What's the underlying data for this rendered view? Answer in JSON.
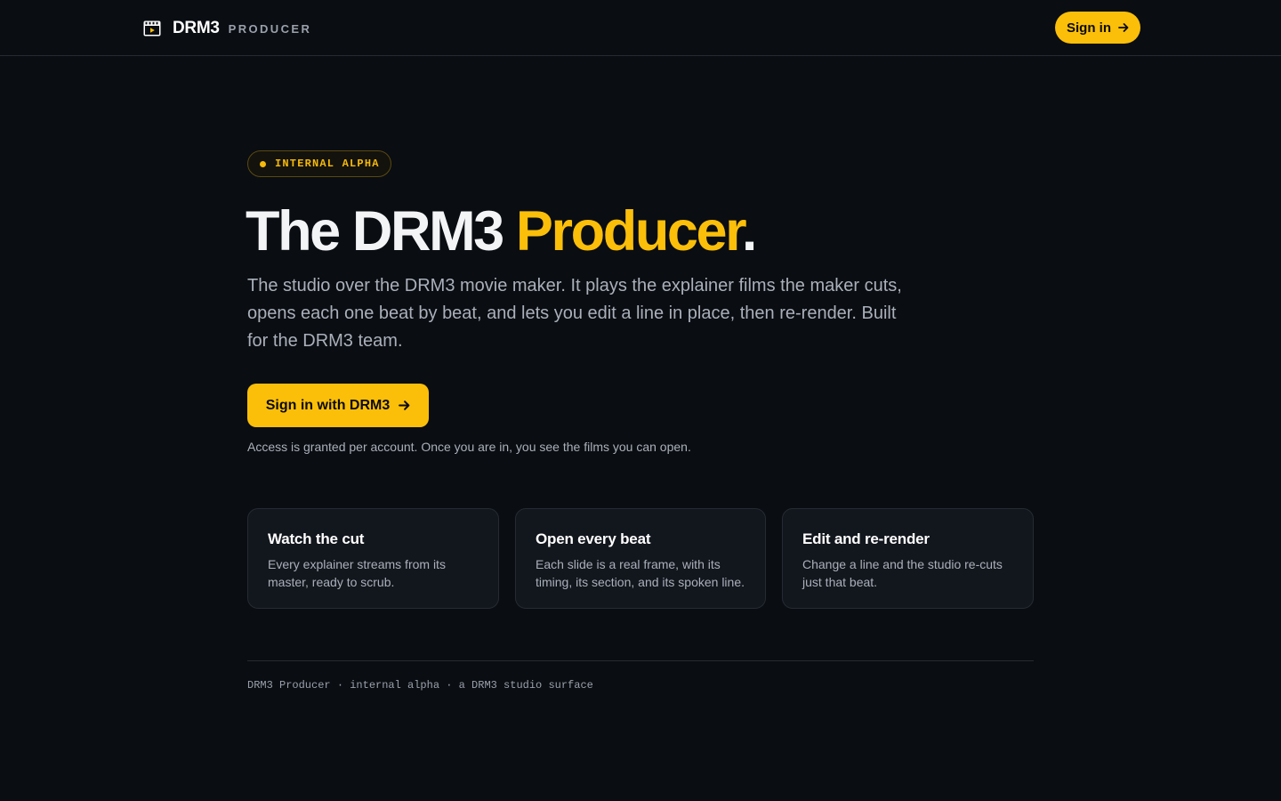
{
  "header": {
    "brand_name": "DRM3",
    "brand_sub": "PRODUCER",
    "brand_icon": "clapperboard-icon",
    "signin_label": "Sign in"
  },
  "hero": {
    "badge": "INTERNAL ALPHA",
    "headline_lead": "The DRM3 ",
    "headline_accent": "Producer",
    "headline_tail": ".",
    "lede": "The studio over the DRM3 movie maker. It plays the explainer films the maker cuts, opens each one beat by beat, and lets you edit a line in place, then re-render. Built for the DRM3 team.",
    "cta_label": "Sign in with DRM3",
    "access_note": "Access is granted per account. Once you are in, you see the films you can open."
  },
  "features": [
    {
      "title": "Watch the cut",
      "body": "Every explainer streams from its master, ready to scrub."
    },
    {
      "title": "Open every beat",
      "body": "Each slide is a real frame, with its timing, its section, and its spoken line."
    },
    {
      "title": "Edit and re-render",
      "body": "Change a line and the studio re-cuts just that beat."
    }
  ],
  "footer": {
    "text": "DRM3 Producer · internal alpha · a DRM3 studio surface"
  },
  "colors": {
    "background": "#0a0d12",
    "accent": "#fbbf0a",
    "card": "#12161d",
    "border": "#262b33",
    "muted_text": "#aab0ba"
  }
}
